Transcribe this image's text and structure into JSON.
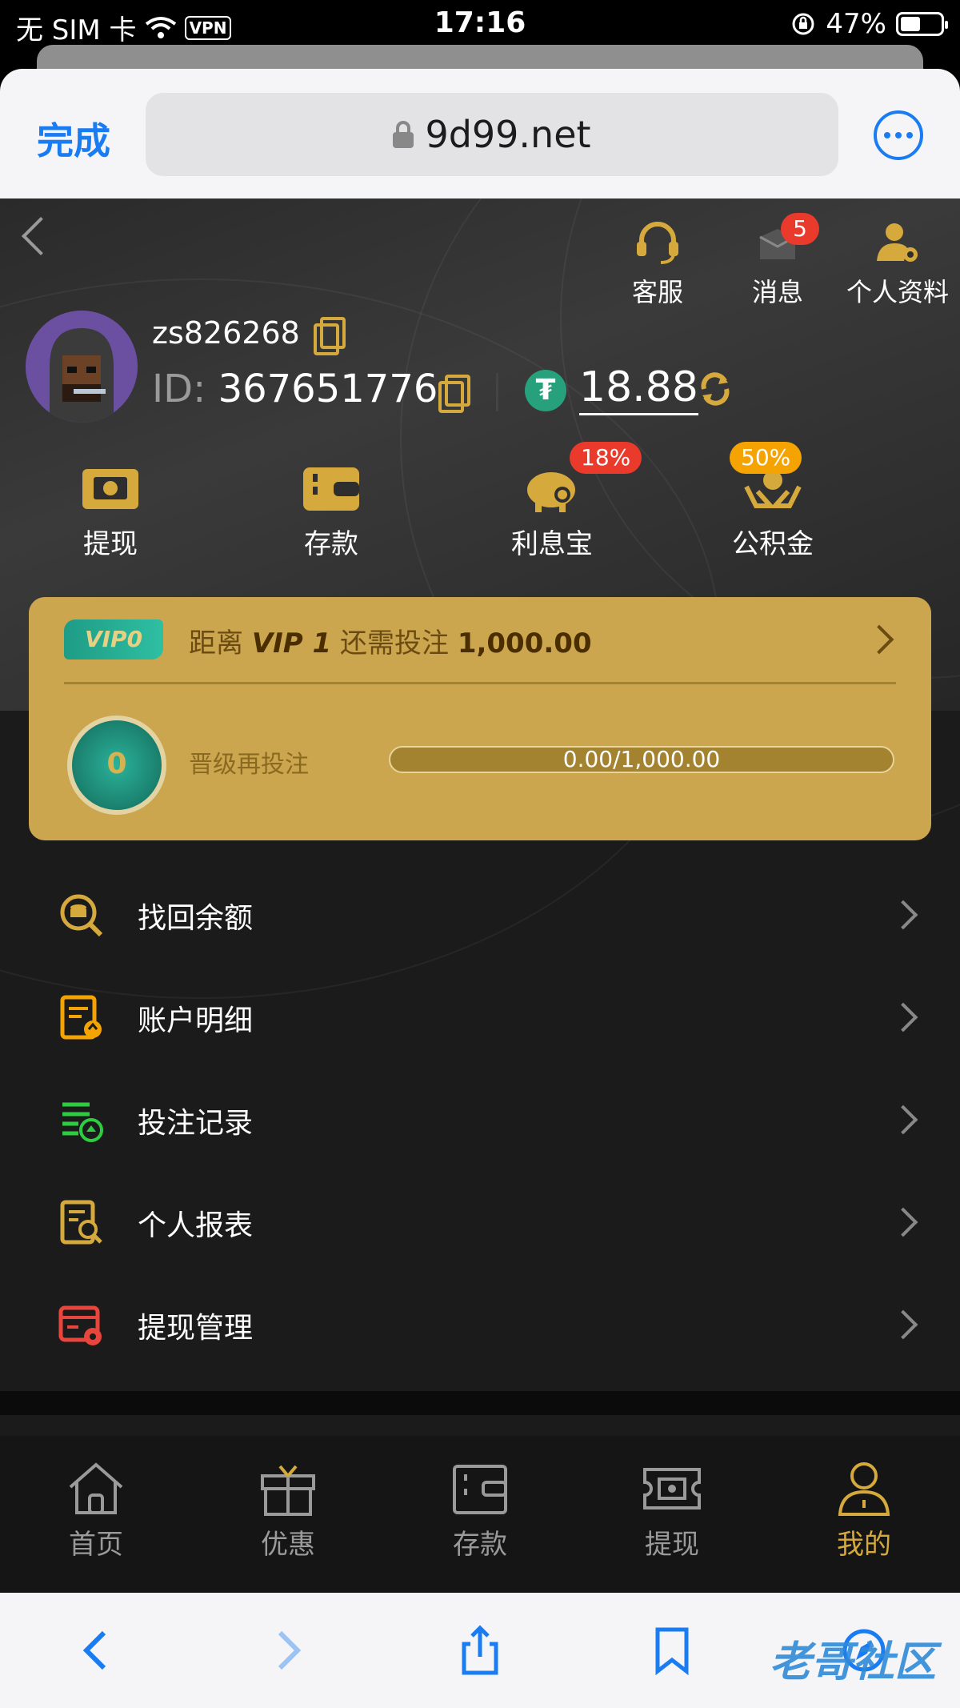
{
  "status_bar": {
    "carrier": "无 SIM 卡",
    "vpn": "VPN",
    "time": "17:16",
    "battery": "47%"
  },
  "browser": {
    "done": "完成",
    "url": "9d99.net"
  },
  "top_actions": [
    {
      "label": "客服",
      "icon": "headset-icon"
    },
    {
      "label": "消息",
      "icon": "message-box-icon",
      "badge": "5"
    },
    {
      "label": "个人资料",
      "icon": "user-settings-icon"
    }
  ],
  "user": {
    "username": "zs826268",
    "id_prefix": "ID:",
    "id": "367651776",
    "currency_symbol": "₮",
    "balance": "18.88"
  },
  "quick_actions": [
    {
      "label": "提现",
      "icon": "withdraw-icon"
    },
    {
      "label": "存款",
      "icon": "wallet-icon"
    },
    {
      "label": "利息宝",
      "icon": "piggy-bank-icon",
      "badge": "18%"
    },
    {
      "label": "公积金",
      "icon": "hands-coin-icon",
      "badge": "50%"
    }
  ],
  "vip": {
    "tag": "VIP0",
    "prefix": "距离",
    "next_level": "VIP 1",
    "middle": "还需投注",
    "amount": "1,000.00",
    "medal_level": "0",
    "sub_label": "晋级再投注",
    "progress_text": "0.00/1,000.00",
    "progress": 0
  },
  "menu": [
    {
      "label": "找回余额",
      "icon": "coin-search-icon"
    },
    {
      "label": "账户明细",
      "icon": "account-detail-icon"
    },
    {
      "label": "投注记录",
      "icon": "bet-record-icon"
    },
    {
      "label": "个人报表",
      "icon": "report-search-icon"
    },
    {
      "label": "提现管理",
      "icon": "withdraw-settings-icon"
    }
  ],
  "tabbar": [
    {
      "label": "首页",
      "icon": "home-icon"
    },
    {
      "label": "优惠",
      "icon": "gift-icon"
    },
    {
      "label": "存款",
      "icon": "wallet-icon"
    },
    {
      "label": "提现",
      "icon": "ticket-icon"
    },
    {
      "label": "我的",
      "icon": "user-icon",
      "active": true
    }
  ],
  "colors": {
    "accent_gold": "#d6a93c",
    "vip_card": "#cba64e",
    "badge_red": "#e93a2c",
    "badge_orange": "#f5a300",
    "safari_blue": "#1a7cf3",
    "usdt_green": "#27a17b"
  },
  "watermark": "老哥社区"
}
